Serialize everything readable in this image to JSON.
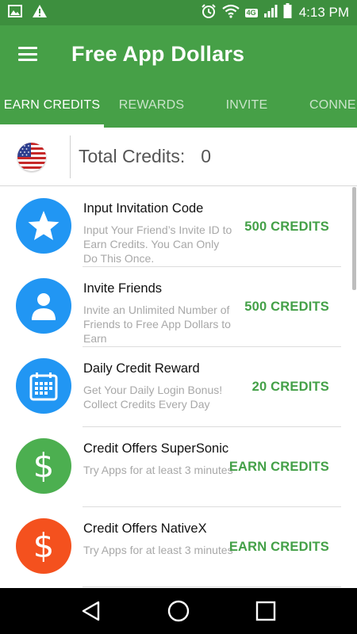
{
  "status_bar": {
    "time": "4:13 PM",
    "network_label": "4G",
    "icons": [
      "image-icon",
      "warning-icon",
      "alarm-icon",
      "wifi-icon",
      "signal-icon",
      "battery-icon"
    ]
  },
  "app_bar": {
    "title": "Free App Dollars",
    "menu_icon": "hamburger-menu-icon",
    "background": "#46a047"
  },
  "tabs": [
    {
      "label": "EARN CREDITS",
      "active": true
    },
    {
      "label": "REWARDS",
      "active": false
    },
    {
      "label": "INVITE",
      "active": false
    },
    {
      "label": "CONNE",
      "active": false
    }
  ],
  "credits": {
    "label": "Total Credits:",
    "value": "0",
    "flag_icon": "us-flag-icon"
  },
  "items": [
    {
      "title": "Input Invitation Code",
      "description": "Input Your Friend’s Invite ID to Earn Credits. You Can Only Do This Once.",
      "action": "500 CREDITS",
      "icon": "star-icon",
      "icon_color": "#2196f3"
    },
    {
      "title": "Invite Friends",
      "description": "Invite an Unlimited Number of Friends to Free App Dollars to Earn",
      "action": "500 CREDITS",
      "icon": "person-icon",
      "icon_color": "#2196f3"
    },
    {
      "title": "Daily Credit Reward",
      "description": "Get Your Daily Login Bonus! Collect Credits Every Day",
      "action": "20 CREDITS",
      "icon": "calendar-icon",
      "icon_color": "#2196f3"
    },
    {
      "title": "Credit Offers SuperSonic",
      "description": "Try Apps for at least 3 minutes",
      "action": "EARN CREDITS",
      "icon": "dollar-icon",
      "icon_color": "#4caf50"
    },
    {
      "title": "Credit Offers NativeX",
      "description": "Try Apps for at least 3 minutes",
      "action": "EARN CREDITS",
      "icon": "dollar-icon",
      "icon_color": "#f4511e"
    }
  ],
  "nav_bar": {
    "buttons": [
      "back-icon",
      "home-icon",
      "recents-icon"
    ]
  },
  "colors": {
    "status_bar": "#3d8f3e",
    "primary": "#46a047",
    "accent_text": "#43a047"
  }
}
